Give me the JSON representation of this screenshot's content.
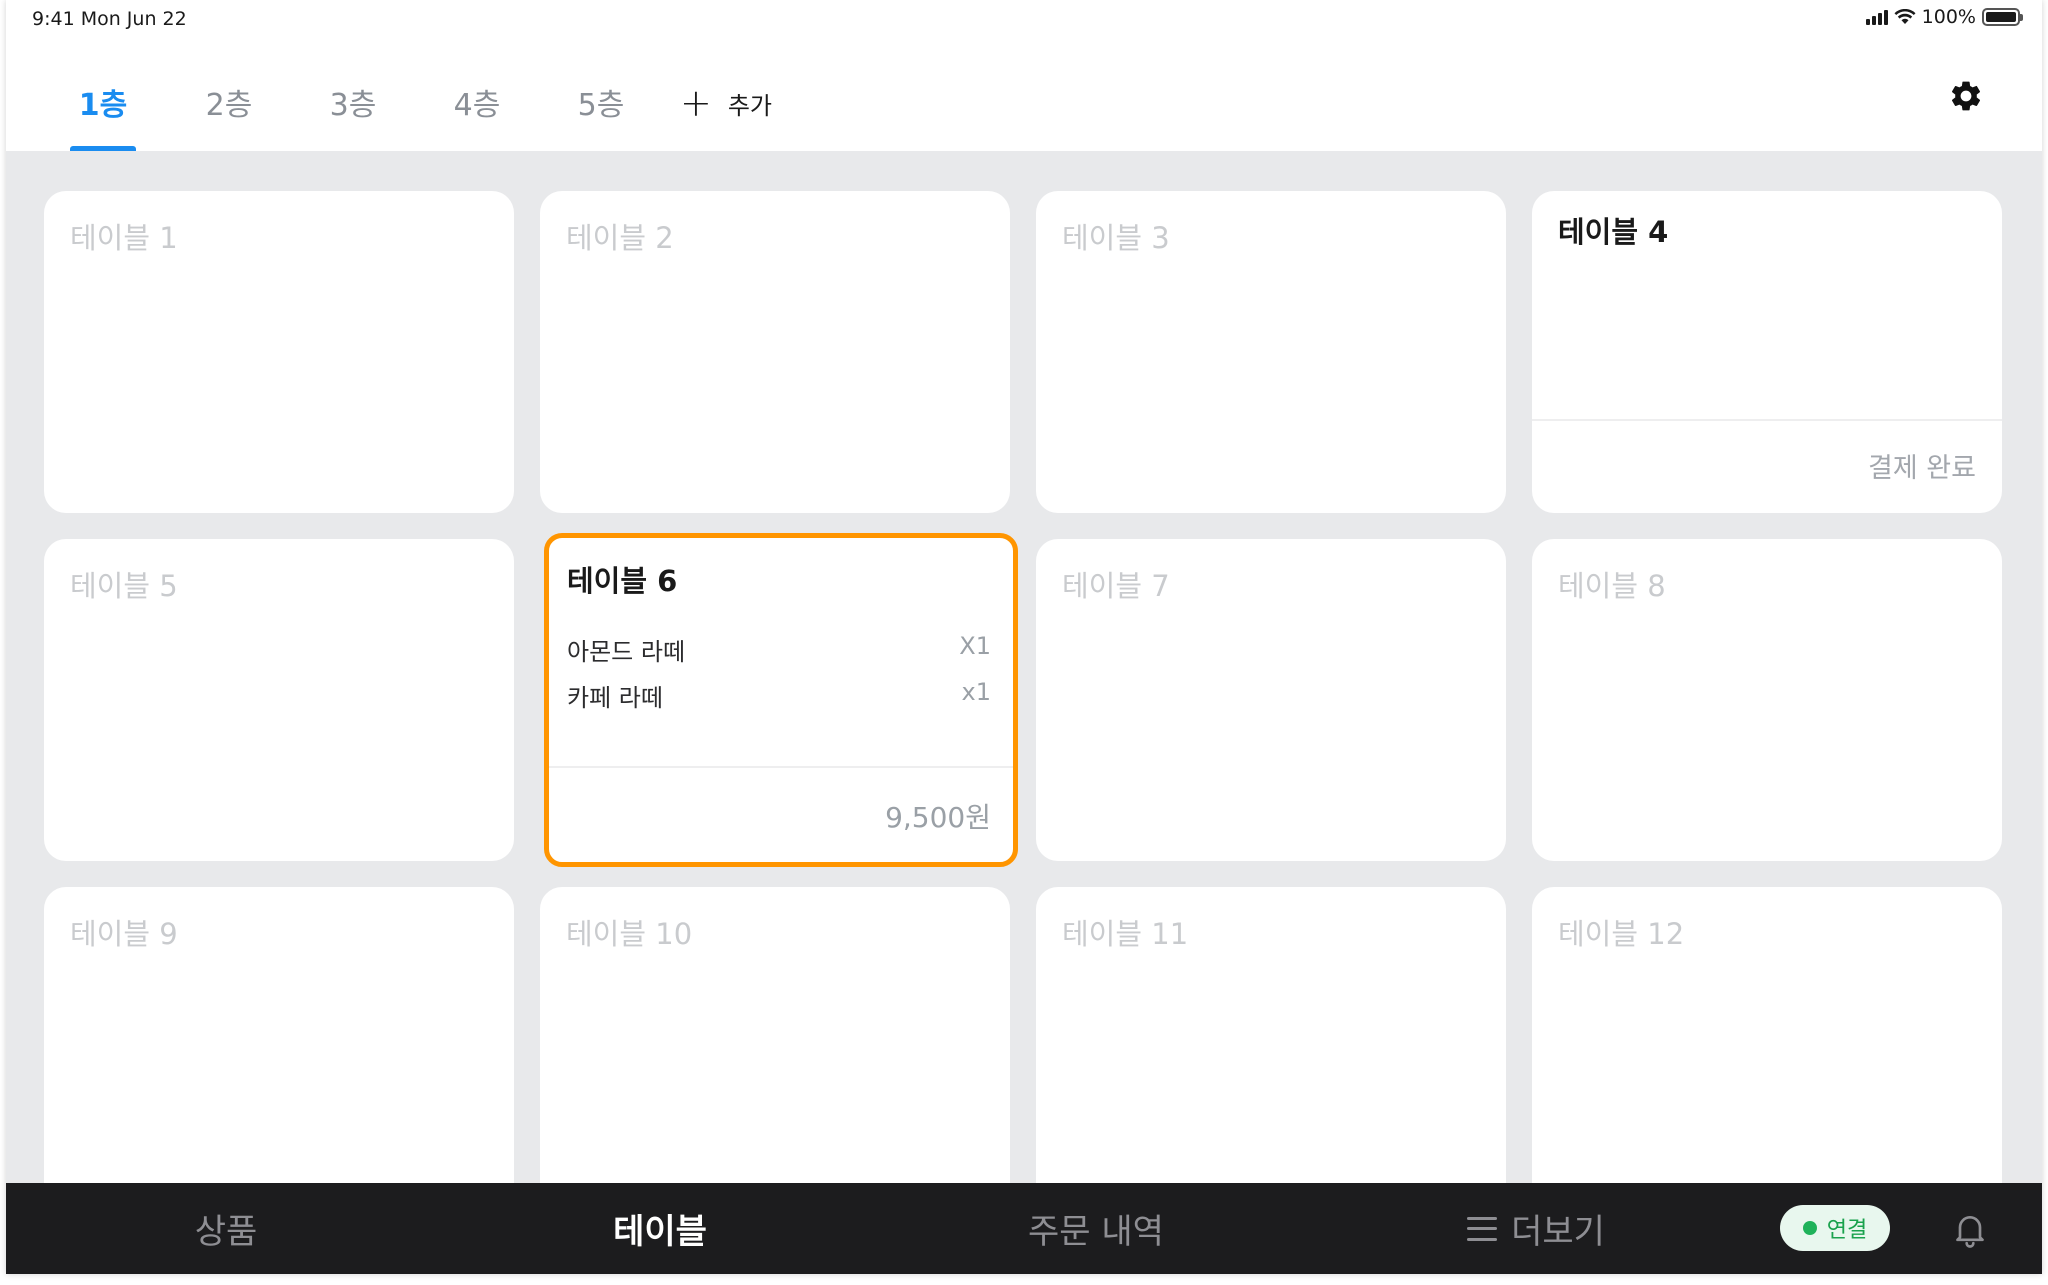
{
  "status_bar": {
    "time": "9:41  Mon Jun 22",
    "battery_text": "100%",
    "battery_level": 1.0
  },
  "floors": {
    "tabs": [
      {
        "label": "1층",
        "active": true
      },
      {
        "label": "2층",
        "active": false
      },
      {
        "label": "3층",
        "active": false
      },
      {
        "label": "4층",
        "active": false
      },
      {
        "label": "5층",
        "active": false
      }
    ],
    "add_label": "추가"
  },
  "tables": [
    {
      "name": "테이블 1",
      "state": "empty"
    },
    {
      "name": "테이블 2",
      "state": "empty"
    },
    {
      "name": "테이블 3",
      "state": "empty"
    },
    {
      "name": "테이블 4",
      "state": "paid",
      "status": "결제 완료"
    },
    {
      "name": "테이블 5",
      "state": "empty"
    },
    {
      "name": "테이블 6",
      "state": "selected",
      "items": [
        {
          "name": "아몬드 라떼",
          "qty": "X1"
        },
        {
          "name": "카페 라떼",
          "qty": "x1"
        }
      ],
      "total": "9,500원"
    },
    {
      "name": "테이블 7",
      "state": "empty"
    },
    {
      "name": "테이블 8",
      "state": "empty"
    },
    {
      "name": "테이블 9",
      "state": "empty"
    },
    {
      "name": "테이블 10",
      "state": "empty"
    },
    {
      "name": "테이블 11",
      "state": "empty"
    },
    {
      "name": "테이블 12",
      "state": "empty"
    }
  ],
  "bottom_nav": {
    "products": "상품",
    "tables": "테이블",
    "orders": "주문 내역",
    "more": "더보기",
    "connection": "연결"
  },
  "colors": {
    "accent_blue": "#1a8cf0",
    "selected_orange": "#ff9500",
    "connected_green": "#1fb25a"
  }
}
